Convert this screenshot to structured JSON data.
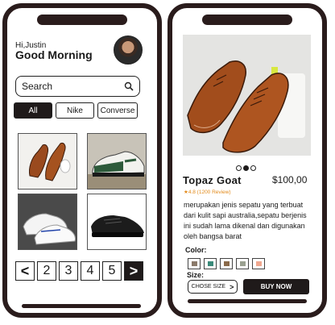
{
  "home": {
    "greeting_name": "Hi,Justin",
    "greeting": "Good Morning",
    "search": {
      "placeholder": "Search"
    },
    "filters": [
      {
        "label": "All",
        "active": true
      },
      {
        "label": "Nike",
        "active": false
      },
      {
        "label": "Converse",
        "active": false
      }
    ],
    "products": [
      {
        "image": "brown-leather-shoe"
      },
      {
        "image": "green-white-sneaker"
      },
      {
        "image": "white-sneaker"
      },
      {
        "image": "black-sneaker"
      }
    ],
    "pagination": {
      "prev": "<",
      "pages": [
        "2",
        "3",
        "4",
        "5"
      ],
      "next": ">"
    }
  },
  "detail": {
    "image": "brown-leather-oxford-shoes",
    "carousel": {
      "count": 3,
      "active": 2
    },
    "name": "Topaz Goat",
    "price": "$100,00",
    "rating": "★4.8 (1200 Review)",
    "description": "merupakan jenis sepatu yang terbuat dari kulit sapi australia,sepatu berjenis ini sudah lama dikenal dan digunakan oleh bangsa barat",
    "color_label": "Color:",
    "colors": [
      "#8a7a6a",
      "#3a8a7a",
      "#8a6a4a",
      "#9aa090",
      "#f0a890"
    ],
    "size_label": "Size:",
    "choose_size": "CHOSE SIZE",
    "buy_now": "BUY NOW"
  },
  "colors": {
    "frame": "#2a1c1c",
    "accent": "#1f1a1a",
    "rating": "#e28a1a"
  }
}
